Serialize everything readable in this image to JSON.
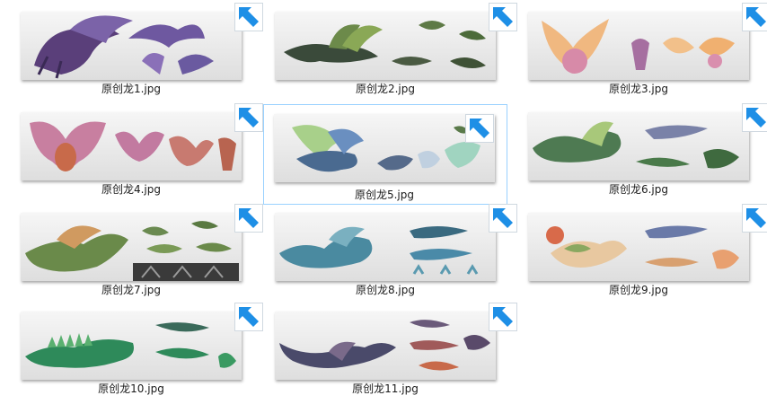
{
  "files": [
    {
      "name": "原创龙1.jpg",
      "icon": "shortcut-arrow-icon"
    },
    {
      "name": "原创龙2.jpg",
      "icon": "shortcut-arrow-icon"
    },
    {
      "name": "原创龙3.jpg",
      "icon": "shortcut-arrow-icon"
    },
    {
      "name": "原创龙4.jpg",
      "icon": "shortcut-arrow-icon"
    },
    {
      "name": "原创龙5.jpg",
      "icon": "shortcut-arrow-icon",
      "selected": true
    },
    {
      "name": "原创龙6.jpg",
      "icon": "shortcut-arrow-icon"
    },
    {
      "name": "原创龙7.jpg",
      "icon": "shortcut-arrow-icon"
    },
    {
      "name": "原创龙8.jpg",
      "icon": "shortcut-arrow-icon"
    },
    {
      "name": "原创龙9.jpg",
      "icon": "shortcut-arrow-icon"
    },
    {
      "name": "原创龙10.jpg",
      "icon": "shortcut-arrow-icon"
    },
    {
      "name": "原创龙11.jpg",
      "icon": "shortcut-arrow-icon"
    }
  ],
  "colors": {
    "selection_border": "#99d1ff",
    "shortcut_arrow": "#1e8fe6"
  }
}
